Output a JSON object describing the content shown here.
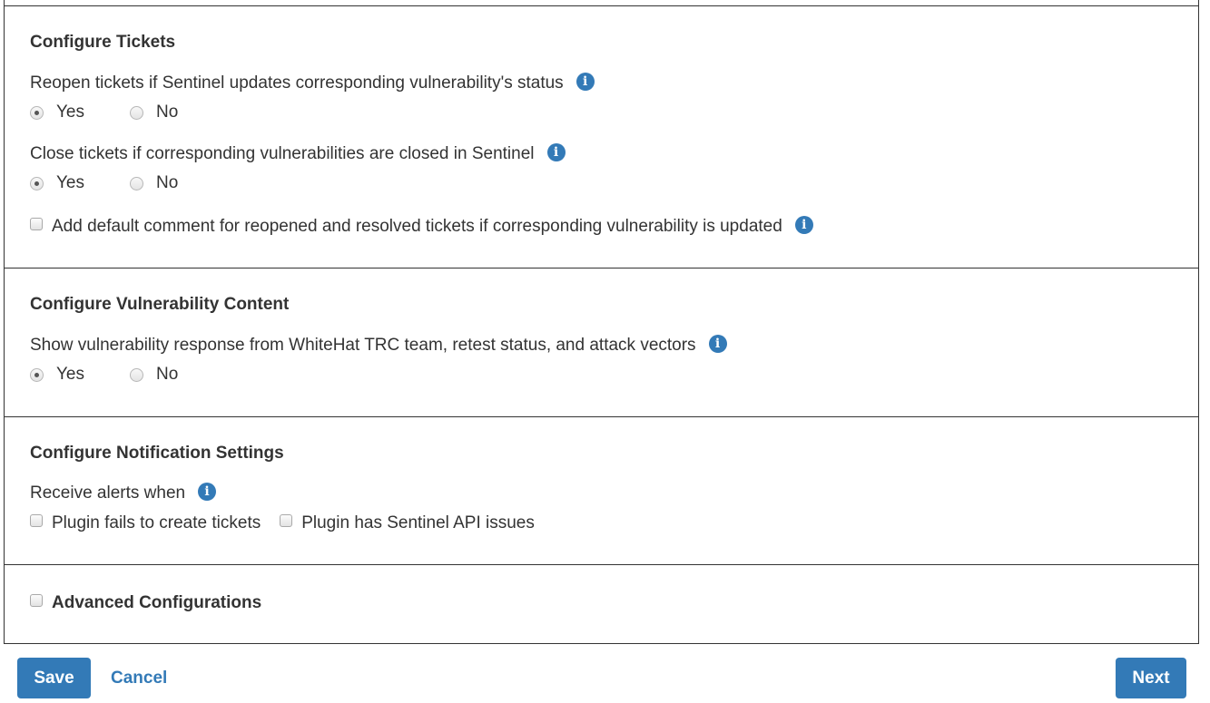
{
  "tickets": {
    "title": "Configure Tickets",
    "reopen": {
      "label": "Reopen tickets if Sentinel updates corresponding vulnerability's status",
      "yes": "Yes",
      "no": "No",
      "selected": "Yes"
    },
    "close": {
      "label": "Close tickets if corresponding vulnerabilities are closed in Sentinel",
      "yes": "Yes",
      "no": "No",
      "selected": "Yes"
    },
    "default_comment": {
      "label": "Add default comment for reopened and resolved tickets if corresponding vulnerability is updated",
      "checked": false
    }
  },
  "vuln_content": {
    "title": "Configure Vulnerability Content",
    "show_response": {
      "label": "Show vulnerability response from WhiteHat TRC team, retest status, and attack vectors",
      "yes": "Yes",
      "no": "No",
      "selected": "Yes"
    }
  },
  "notifications": {
    "title": "Configure Notification Settings",
    "receive_label": "Receive alerts when",
    "options": [
      {
        "label": "Plugin fails to create tickets",
        "checked": false
      },
      {
        "label": "Plugin has Sentinel API issues",
        "checked": false
      }
    ]
  },
  "advanced": {
    "label": "Advanced Configurations",
    "checked": false
  },
  "info_glyph": "i",
  "footer": {
    "save": "Save",
    "cancel": "Cancel",
    "next": "Next"
  },
  "colors": {
    "primary": "#337ab7",
    "border": "#333333"
  }
}
